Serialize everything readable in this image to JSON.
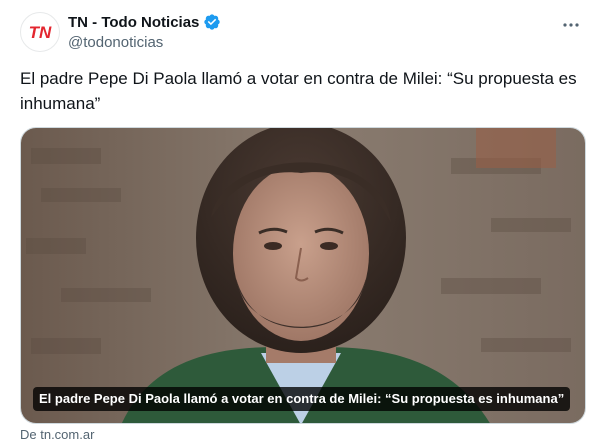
{
  "author": {
    "display_name": "TN - Todo Noticias",
    "handle": "@todonoticias",
    "avatar_icon": "tn-logo-icon",
    "verified_icon": "verified-badge-icon",
    "verified_color": "#1d9bf0",
    "logo_text": "TN"
  },
  "menu": {
    "icon": "more-dots-icon"
  },
  "tweet": {
    "text": "El padre Pepe Di Paola llamó a votar en contra de Milei: “Su propuesta es inhumana”"
  },
  "card": {
    "caption": "El padre Pepe Di Paola llamó a votar en contra de Milei: “Su propuesta es inhumana”",
    "source": "De tn.com.ar"
  }
}
